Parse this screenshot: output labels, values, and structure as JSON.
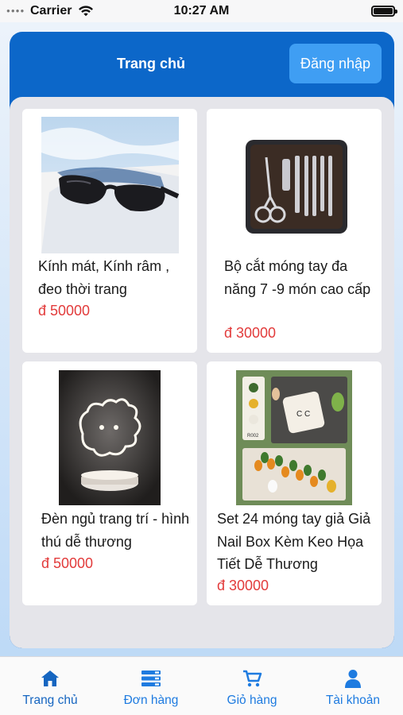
{
  "status_bar": {
    "carrier": "Carrier",
    "time": "10:27 AM"
  },
  "header": {
    "title": "Trang chủ",
    "login_label": "Đăng nhập"
  },
  "products": [
    {
      "name": "Kính mát, Kính râm , đeo thời trang",
      "price": "đ 50000"
    },
    {
      "name": "Bộ cắt móng tay đa năng 7 -9  món cao cấp",
      "price": "đ 30000"
    },
    {
      "name": "Đèn ngủ  trang trí - hình  thú dễ thương",
      "price": "đ 50000"
    },
    {
      "name": "Set 24 móng tay giả Giả Nail Box Kèm Keo Họa Tiết Dễ Thương",
      "price": "đ 30000"
    }
  ],
  "product_card_image_text": "R002",
  "tabs": [
    {
      "label": "Trang chủ",
      "icon": "home-icon"
    },
    {
      "label": "Đơn hàng",
      "icon": "list-icon"
    },
    {
      "label": "Giỏ hàng",
      "icon": "cart-icon"
    },
    {
      "label": "Tài khoản",
      "icon": "user-icon"
    }
  ],
  "colors": {
    "primary": "#0c67c9",
    "login_button": "#3f9ef3",
    "price": "#e23b3b",
    "tab_active": "#1565c0",
    "tab": "#1e7be0"
  }
}
